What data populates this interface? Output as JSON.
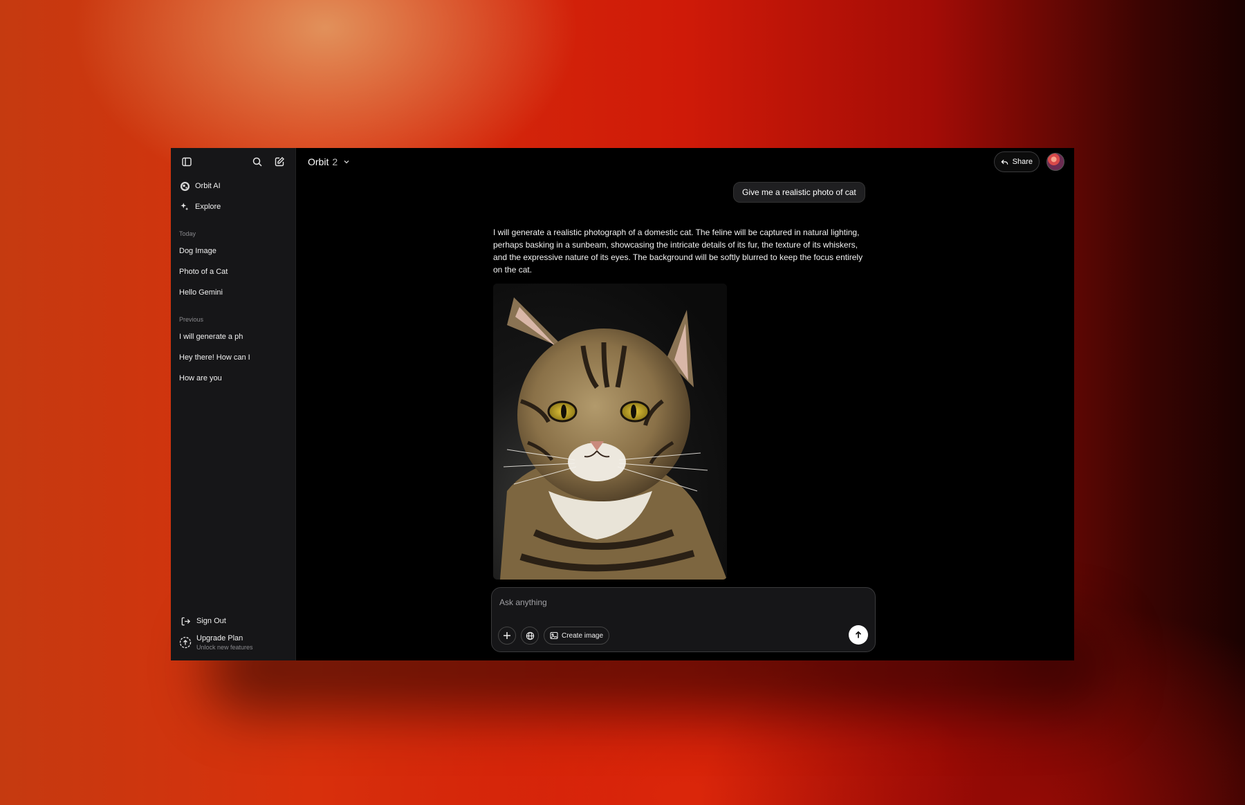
{
  "sidebar": {
    "nav": [
      {
        "label": "Orbit AI",
        "icon": "orbit-logo-icon"
      },
      {
        "label": "Explore",
        "icon": "sparkle-icon"
      }
    ],
    "today_label": "Today",
    "today": [
      {
        "label": "Dog Image"
      },
      {
        "label": "Photo of a Cat"
      },
      {
        "label": "Hello Gemini"
      }
    ],
    "previous_label": "Previous",
    "previous": [
      {
        "label": "I will generate a ph"
      },
      {
        "label": "Hey there! How can I"
      },
      {
        "label": "How are you"
      }
    ],
    "sign_out": "Sign Out",
    "upgrade": {
      "title": "Upgrade Plan",
      "subtitle": "Unlock new features"
    }
  },
  "header": {
    "model_name": "Orbit",
    "model_version": "2",
    "share_label": "Share"
  },
  "chat": {
    "user_message": "Give me a realistic photo of cat",
    "assistant_text": "I will generate a realistic photograph of a domestic cat. The feline will be captured in natural lighting, perhaps basking in a sunbeam, showcasing the intricate details of its fur, the texture of its whiskers, and the expressive nature of its eyes. The background will be softly blurred to keep the focus entirely on the cat."
  },
  "composer": {
    "placeholder": "Ask anything",
    "create_image_label": "Create image"
  },
  "colors": {
    "window_bg": "#000000",
    "sidebar_bg": "#161618",
    "text": "#f0f0f0",
    "muted": "#8a8a8e"
  }
}
